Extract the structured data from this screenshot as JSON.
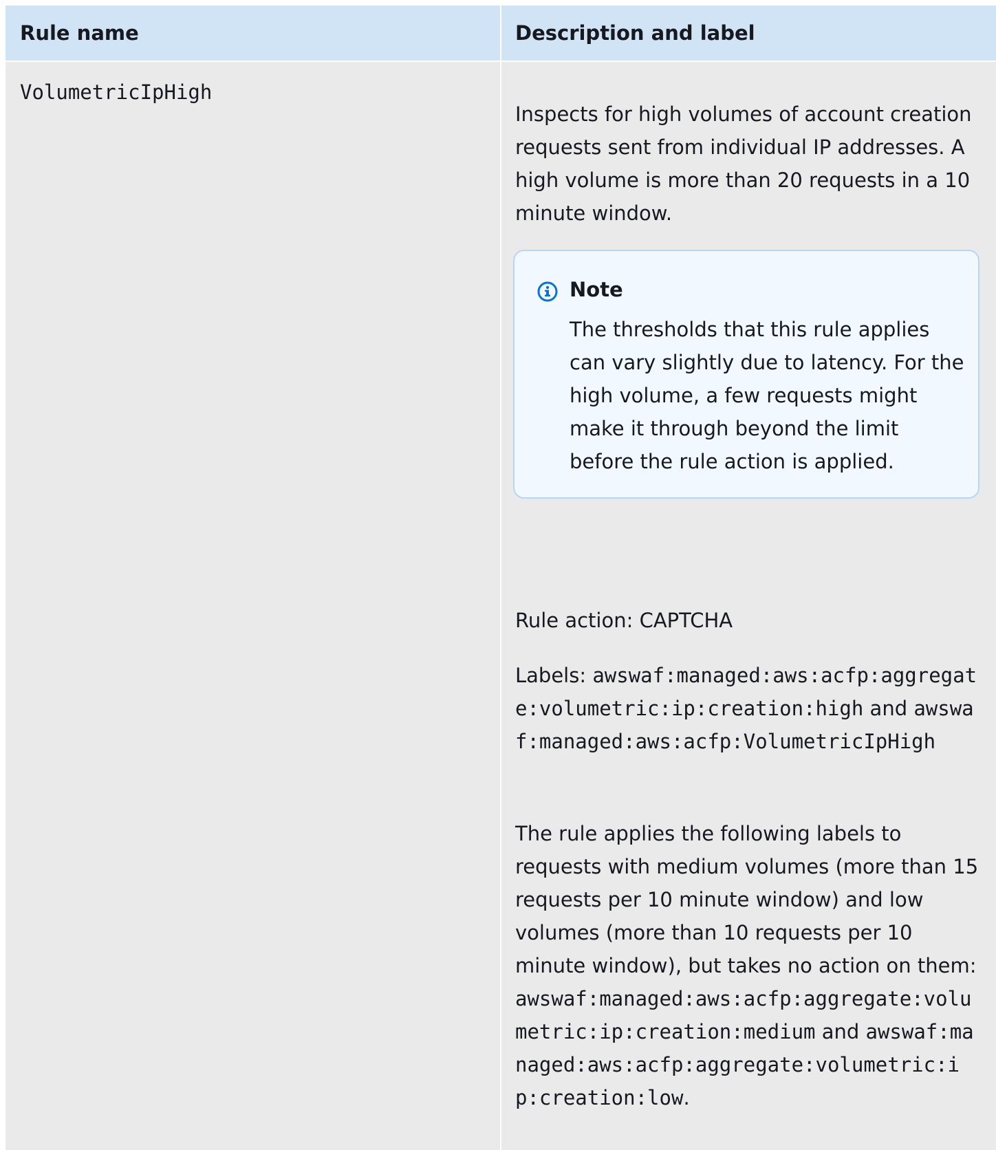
{
  "table": {
    "headers": [
      "Rule name",
      "Description and label"
    ],
    "rows": [
      {
        "rule_name": "VolumetricIpHigh",
        "description": "Inspects for high volumes of account creation requests sent from individual IP addresses. A high volume is more than 20 requests in a 10 minute window.",
        "note": {
          "title": "Note",
          "body": "The thresholds that this rule applies can vary slightly due to latency. For the high volume, a few requests might make it through beyond the limit before the rule action is applied."
        },
        "rule_action": "Rule action: CAPTCHA",
        "labels_prefix": "Labels: ",
        "label_1": "awswaf:managed:aws:acfp:aggregate:volumetric:ip:creation:high",
        "labels_and": " and ",
        "label_2": "awswaf:managed:aws:acfp:VolumetricIpHigh",
        "additional_text": "The rule applies the following labels to requests with medium volumes (more than 15 requests per 10 minute window) and low volumes (more than 10 requests per 10 minute window), but takes no action on them: ",
        "label_medium": "awswaf:managed:aws:acfp:aggregate:volumetric:ip:creation:medium",
        "additional_and": " and ",
        "label_low": "awswaf:managed:aws:acfp:aggregate:volumetric:ip:creation:low",
        "period": "."
      }
    ]
  },
  "icons": {
    "note_icon": "info-icon"
  },
  "colors": {
    "header_bg": "#d1e4f6",
    "row_bg": "#eaeaeb",
    "note_bg": "#f1f8ff",
    "note_border": "#b8d6f2",
    "info_icon": "#0972d3"
  }
}
